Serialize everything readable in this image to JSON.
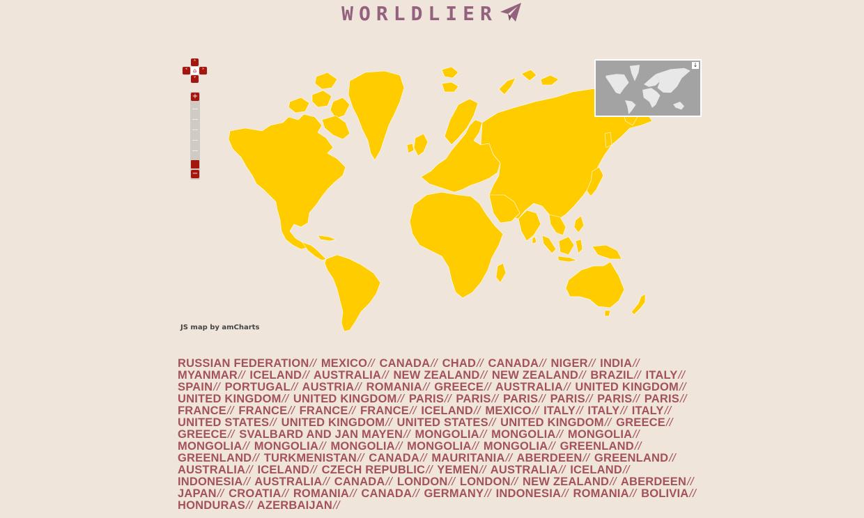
{
  "header": {
    "title": "WORLDLIER",
    "logo_icon": "paper-plane-icon"
  },
  "map": {
    "land_color": "#ffcc00",
    "background_color": "#efe5da",
    "control_color": "#a3170f",
    "credit": "JS map by amCharts",
    "controls": {
      "pan_up": "pan-up-icon",
      "pan_down": "pan-down-icon",
      "pan_left": "pan-left-icon",
      "pan_right": "pan-right-icon",
      "home": "home-icon",
      "zoom_in_label": "+",
      "zoom_out_label": "−"
    },
    "minimap": {
      "toggle_icon": "arrow-down-icon"
    }
  },
  "places": {
    "separator": "//",
    "items": [
      "RUSSIAN FEDERATION",
      "MEXICO",
      "CANADA",
      "CHAD",
      "CANADA",
      "NIGER",
      "INDIA",
      "MYANMAR",
      "ICELAND",
      "AUSTRALIA",
      "NEW ZEALAND",
      "NEW ZEALAND",
      "BRAZIL",
      "ITALY",
      "SPAIN",
      "PORTUGAL",
      "AUSTRIA",
      "ROMANIA",
      "GREECE",
      "AUSTRALIA",
      "UNITED KINGDOM",
      "UNITED KINGDOM",
      "UNITED KINGDOM",
      "PARIS",
      "PARIS",
      "PARIS",
      "PARIS",
      "PARIS",
      "PARIS",
      "FRANCE",
      "FRANCE",
      "FRANCE",
      "FRANCE",
      "ICELAND",
      "MEXICO",
      "ITALY",
      "ITALY",
      "ITALY",
      "UNITED STATES",
      "UNITED KINGDOM",
      "UNITED STATES",
      "UNITED KINGDOM",
      "GREECE",
      "GREECE",
      "SVALBARD AND JAN MAYEN",
      "MONGOLIA",
      "MONGOLIA",
      "MONGOLIA",
      "MONGOLIA",
      "MONGOLIA",
      "MONGOLIA",
      "MONGOLIA",
      "MONGOLIA",
      "GREENLAND",
      "GREENLAND",
      "TURKMENISTAN",
      "CANADA",
      "MAURITANIA",
      "ABERDEEN",
      "GREENLAND",
      "AUSTRALIA",
      "ICELAND",
      "CZECH REPUBLIC",
      "YEMEN",
      "AUSTRALIA",
      "ICELAND",
      "INDONESIA",
      "AUSTRALIA",
      "CANADA",
      "LONDON",
      "LONDON",
      "NEW ZEALAND",
      "ABERDEEN",
      "JAPAN",
      "CROATIA",
      "ROMANIA",
      "CANADA",
      "GERMANY",
      "INDONESIA",
      "ROMANIA",
      "BOLIVIA",
      "HONDURAS",
      "AZERBAIJAN"
    ]
  }
}
